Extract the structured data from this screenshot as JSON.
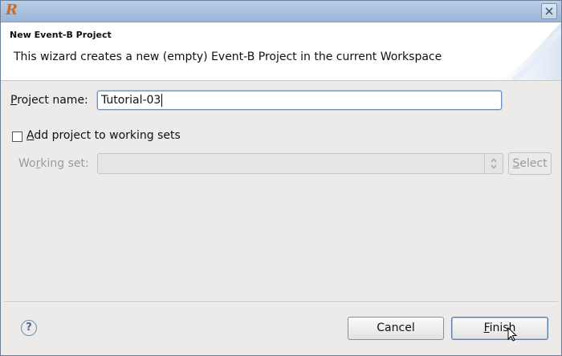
{
  "window": {
    "title_icon": "rodin-logo-icon",
    "close_icon": "close-icon"
  },
  "header": {
    "title": "New Event-B Project",
    "description": "This wizard creates a new (empty) Event-B Project in the current Workspace"
  },
  "form": {
    "project_name": {
      "label_mnemonic": "P",
      "label_rest": "roject name:",
      "value": "Tutorial-03"
    },
    "working_sets_checkbox": {
      "label_mnemonic": "A",
      "label_rest": "dd project to working sets",
      "checked": false
    },
    "working_set": {
      "label_pre": "Wo",
      "label_mnemonic": "r",
      "label_post": "king set:",
      "value": "",
      "enabled": false
    },
    "select_button": {
      "label_mnemonic": "S",
      "label_rest": "elect",
      "enabled": false
    }
  },
  "footer": {
    "help_icon": "help-icon",
    "cancel_label": "Cancel",
    "finish_mnemonic": "F",
    "finish_rest": "inish"
  },
  "colors": {
    "titlebar": "#9bb5d6",
    "dialog_bg": "#ecebe9",
    "focus_border": "#6f8fb8"
  }
}
